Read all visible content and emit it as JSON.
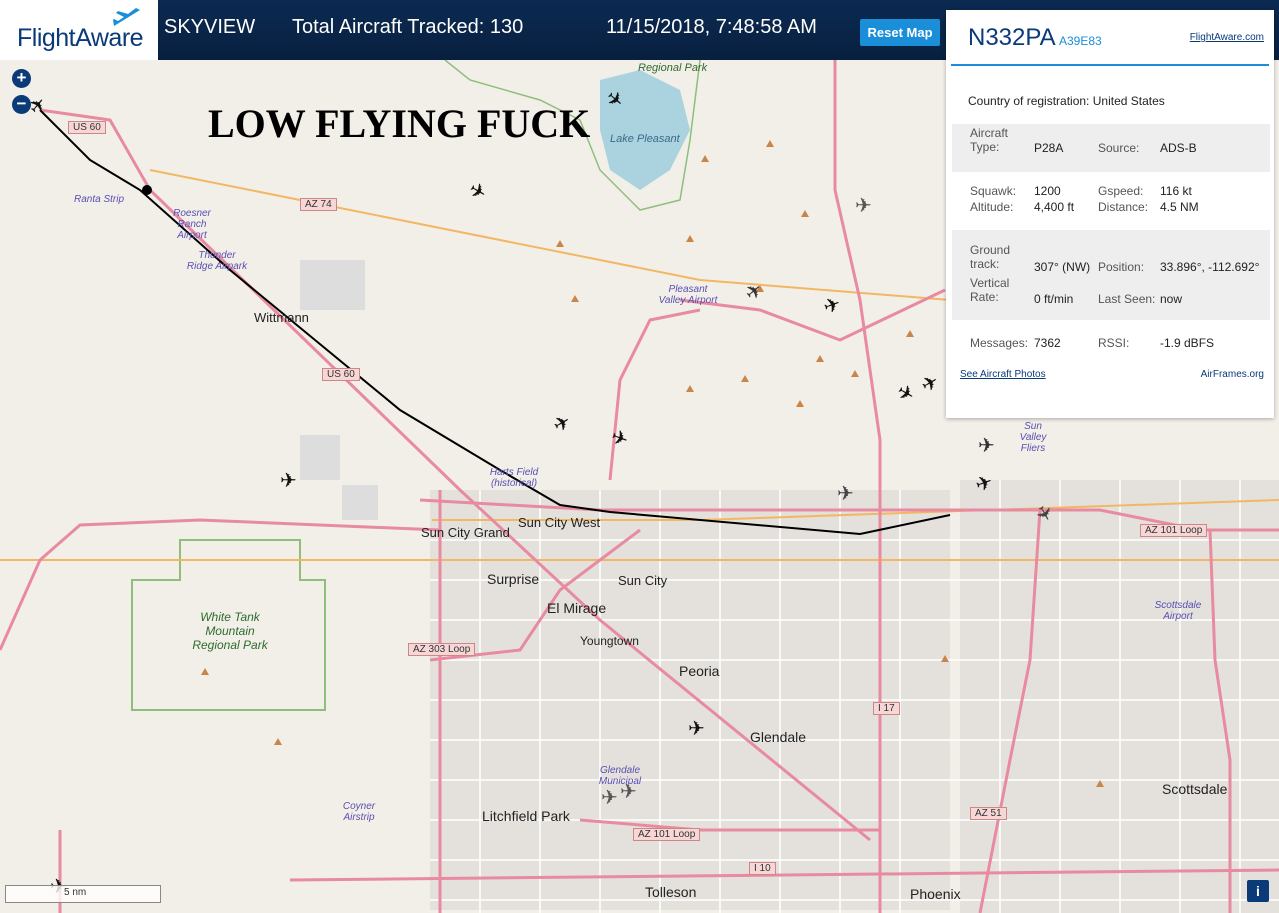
{
  "header": {
    "logo_text": "FlightAware",
    "app_name": "SKYVIEW",
    "tracked": "Total Aircraft Tracked: 130",
    "datetime": "11/15/2018, 7:48:58 AM",
    "reset_label": "Reset Map"
  },
  "map": {
    "caption": "LOW FLYING FUCK",
    "zoom_in": "+",
    "zoom_out": "−",
    "scale_label": "5 nm",
    "info_label": "i",
    "cities": [
      {
        "name": "Wittmann"
      },
      {
        "name": "Sun City Grand"
      },
      {
        "name": "Sun City West"
      },
      {
        "name": "Surprise"
      },
      {
        "name": "Sun City"
      },
      {
        "name": "El Mirage"
      },
      {
        "name": "Youngtown"
      },
      {
        "name": "Peoria"
      },
      {
        "name": "Glendale"
      },
      {
        "name": "Litchfield Park"
      },
      {
        "name": "Tolleson"
      },
      {
        "name": "Phoenix"
      },
      {
        "name": "Scottsdale"
      }
    ],
    "airports": {
      "ranta": "Ranta Strip",
      "roesner": "Roesner Ranch Airport",
      "thunder": "Thunder Ridge Airpark",
      "pleasant": "Pleasant Valley Airport",
      "harts": "Harts Field (historical)",
      "glendale": "Glendale Municipal",
      "coyner": "Coyner Airstrip",
      "sunvalley": "Sun Valley Fliers",
      "scottsdale": "Scottsdale Airport"
    },
    "parks": {
      "regional": "Regional Park",
      "lake": "Lake Pleasant",
      "whitetank": "White Tank Mountain Regional Park"
    },
    "highways": {
      "us60a": "US 60",
      "az74": "AZ 74",
      "us60b": "US 60",
      "az303": "AZ 303 Loop",
      "az101a": "AZ 101 Loop",
      "az101b": "AZ 101 Loop",
      "i17": "I 17",
      "i10": "I 10",
      "az51": "AZ 51"
    }
  },
  "panel": {
    "registration": "N332PA",
    "hex": "A39E83",
    "site_link": "FlightAware.com",
    "country_label": "Country of registration:",
    "country_value": "United States",
    "aircraft_type_label": "Aircraft Type:",
    "aircraft_type": "P28A",
    "source_label": "Source:",
    "source": "ADS-B",
    "squawk_label": "Squawk:",
    "squawk": "1200",
    "gspeed_label": "Gspeed:",
    "gspeed": "116 kt",
    "altitude_label": "Altitude:",
    "altitude": "4,400 ft",
    "distance_label": "Distance:",
    "distance": "4.5 NM",
    "track_label": "Ground track:",
    "track": "307° (NW)",
    "position_label": "Position:",
    "position": "33.896°, -112.692°",
    "vrate_label": "Vertical Rate:",
    "vrate": "0 ft/min",
    "lastseen_label": "Last Seen:",
    "lastseen": "now",
    "messages_label": "Messages:",
    "messages": "7362",
    "rssi_label": "RSSI:",
    "rssi": "-1.9 dBFS",
    "photos_link": "See Aircraft Photos",
    "airframes_link": "AirFrames.org"
  },
  "colors": {
    "brand": "#0a3a78",
    "accent": "#1a8ed8",
    "header_bg": "#0b2a52",
    "track": "#000000"
  }
}
